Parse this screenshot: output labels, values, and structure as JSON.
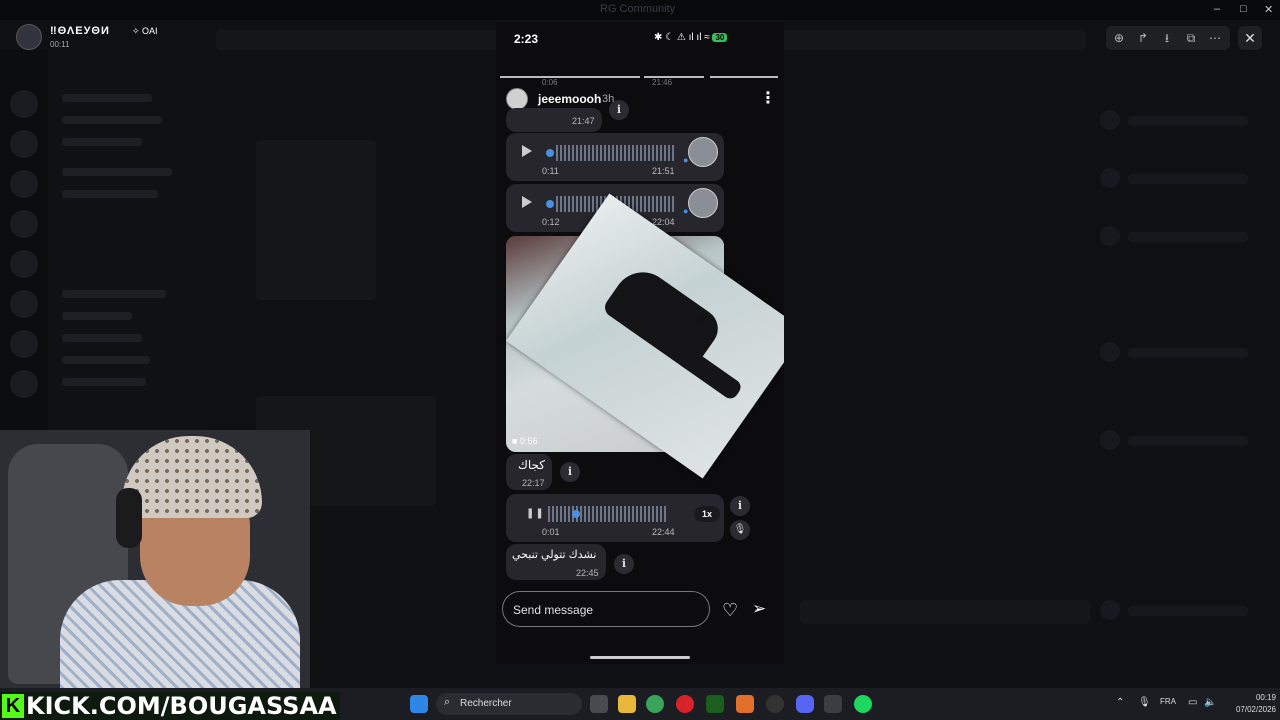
{
  "window": {
    "title": "RG Community",
    "minimize": "–",
    "maximize": "□",
    "close": "✕"
  },
  "streamer": {
    "name": "‼ΘΛЕУΘИ",
    "badge": "✧ OAI",
    "timer": "00:11"
  },
  "viewer_tools": {
    "zoom": "⊕",
    "forward": "↱",
    "download": "⭳",
    "open": "⧉",
    "more": "⋯",
    "close": "✕"
  },
  "phone": {
    "clock": "2:23",
    "status_icons": "✱ ☾ ⚠ ıl ıl ≈",
    "battery": "30",
    "prev_time_left": "0:06",
    "prev_time_right": "21:46",
    "header": {
      "username": "jeeemoooh",
      "age": "3h"
    },
    "messages": [
      {
        "kind": "text",
        "time": "21:47"
      },
      {
        "kind": "voice",
        "duration": "0:11",
        "time": "21:51"
      },
      {
        "kind": "voice",
        "duration": "0:12",
        "time": "22:04"
      },
      {
        "kind": "video",
        "duration": "0:56"
      },
      {
        "kind": "text",
        "text": "كجاك",
        "time": "22:17"
      },
      {
        "kind": "voice_playing",
        "elapsed": "0:01",
        "time": "22:44",
        "speed": "1x"
      },
      {
        "kind": "text",
        "text": "نشدك تتولي تنبحي",
        "time": "22:45"
      }
    ],
    "composer_placeholder": "Send message"
  },
  "kick": {
    "logo": "K",
    "url": "KICK.COM/BOUGASSAA"
  },
  "taskbar": {
    "search_label": "Rechercher",
    "lang": "FRA",
    "time": "00:19",
    "date": "07/02/2026"
  }
}
